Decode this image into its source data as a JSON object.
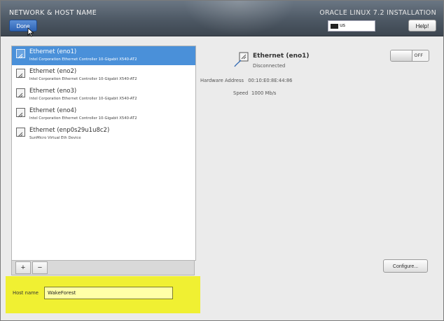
{
  "header": {
    "title": "NETWORK & HOST NAME",
    "product": "ORACLE LINUX 7.2 INSTALLATION",
    "done_label": "Done",
    "help_label": "Help!",
    "keyboard_layout": "us"
  },
  "devices": [
    {
      "name": "Ethernet (eno1)",
      "description": "Intel Corporation Ethernet Controller 10-Gigabit X540-AT2",
      "selected": true
    },
    {
      "name": "Ethernet (eno2)",
      "description": "Intel Corporation Ethernet Controller 10-Gigabit X540-AT2",
      "selected": false
    },
    {
      "name": "Ethernet (eno3)",
      "description": "Intel Corporation Ethernet Controller 10-Gigabit X540-AT2",
      "selected": false
    },
    {
      "name": "Ethernet (eno4)",
      "description": "Intel Corporation Ethernet Controller 10-Gigabit X540-AT2",
      "selected": false
    },
    {
      "name": "Ethernet (enp0s29u1u8c2)",
      "description": "SunMicro Virtual Eth Device",
      "selected": false
    }
  ],
  "list_toolbar": {
    "add_label": "+",
    "remove_label": "−"
  },
  "detail": {
    "name": "Ethernet (eno1)",
    "status": "Disconnected",
    "hardware_address_label": "Hardware Address",
    "hardware_address": "00:10:E0:8E:44:86",
    "speed_label": "Speed",
    "speed": "1000 Mb/s",
    "toggle_state": "OFF",
    "configure_label": "Configure..."
  },
  "hostname": {
    "label": "Host name",
    "value": "WakeForest"
  },
  "colors": {
    "selection": "#4a90d9",
    "highlight": "#f0f032"
  }
}
